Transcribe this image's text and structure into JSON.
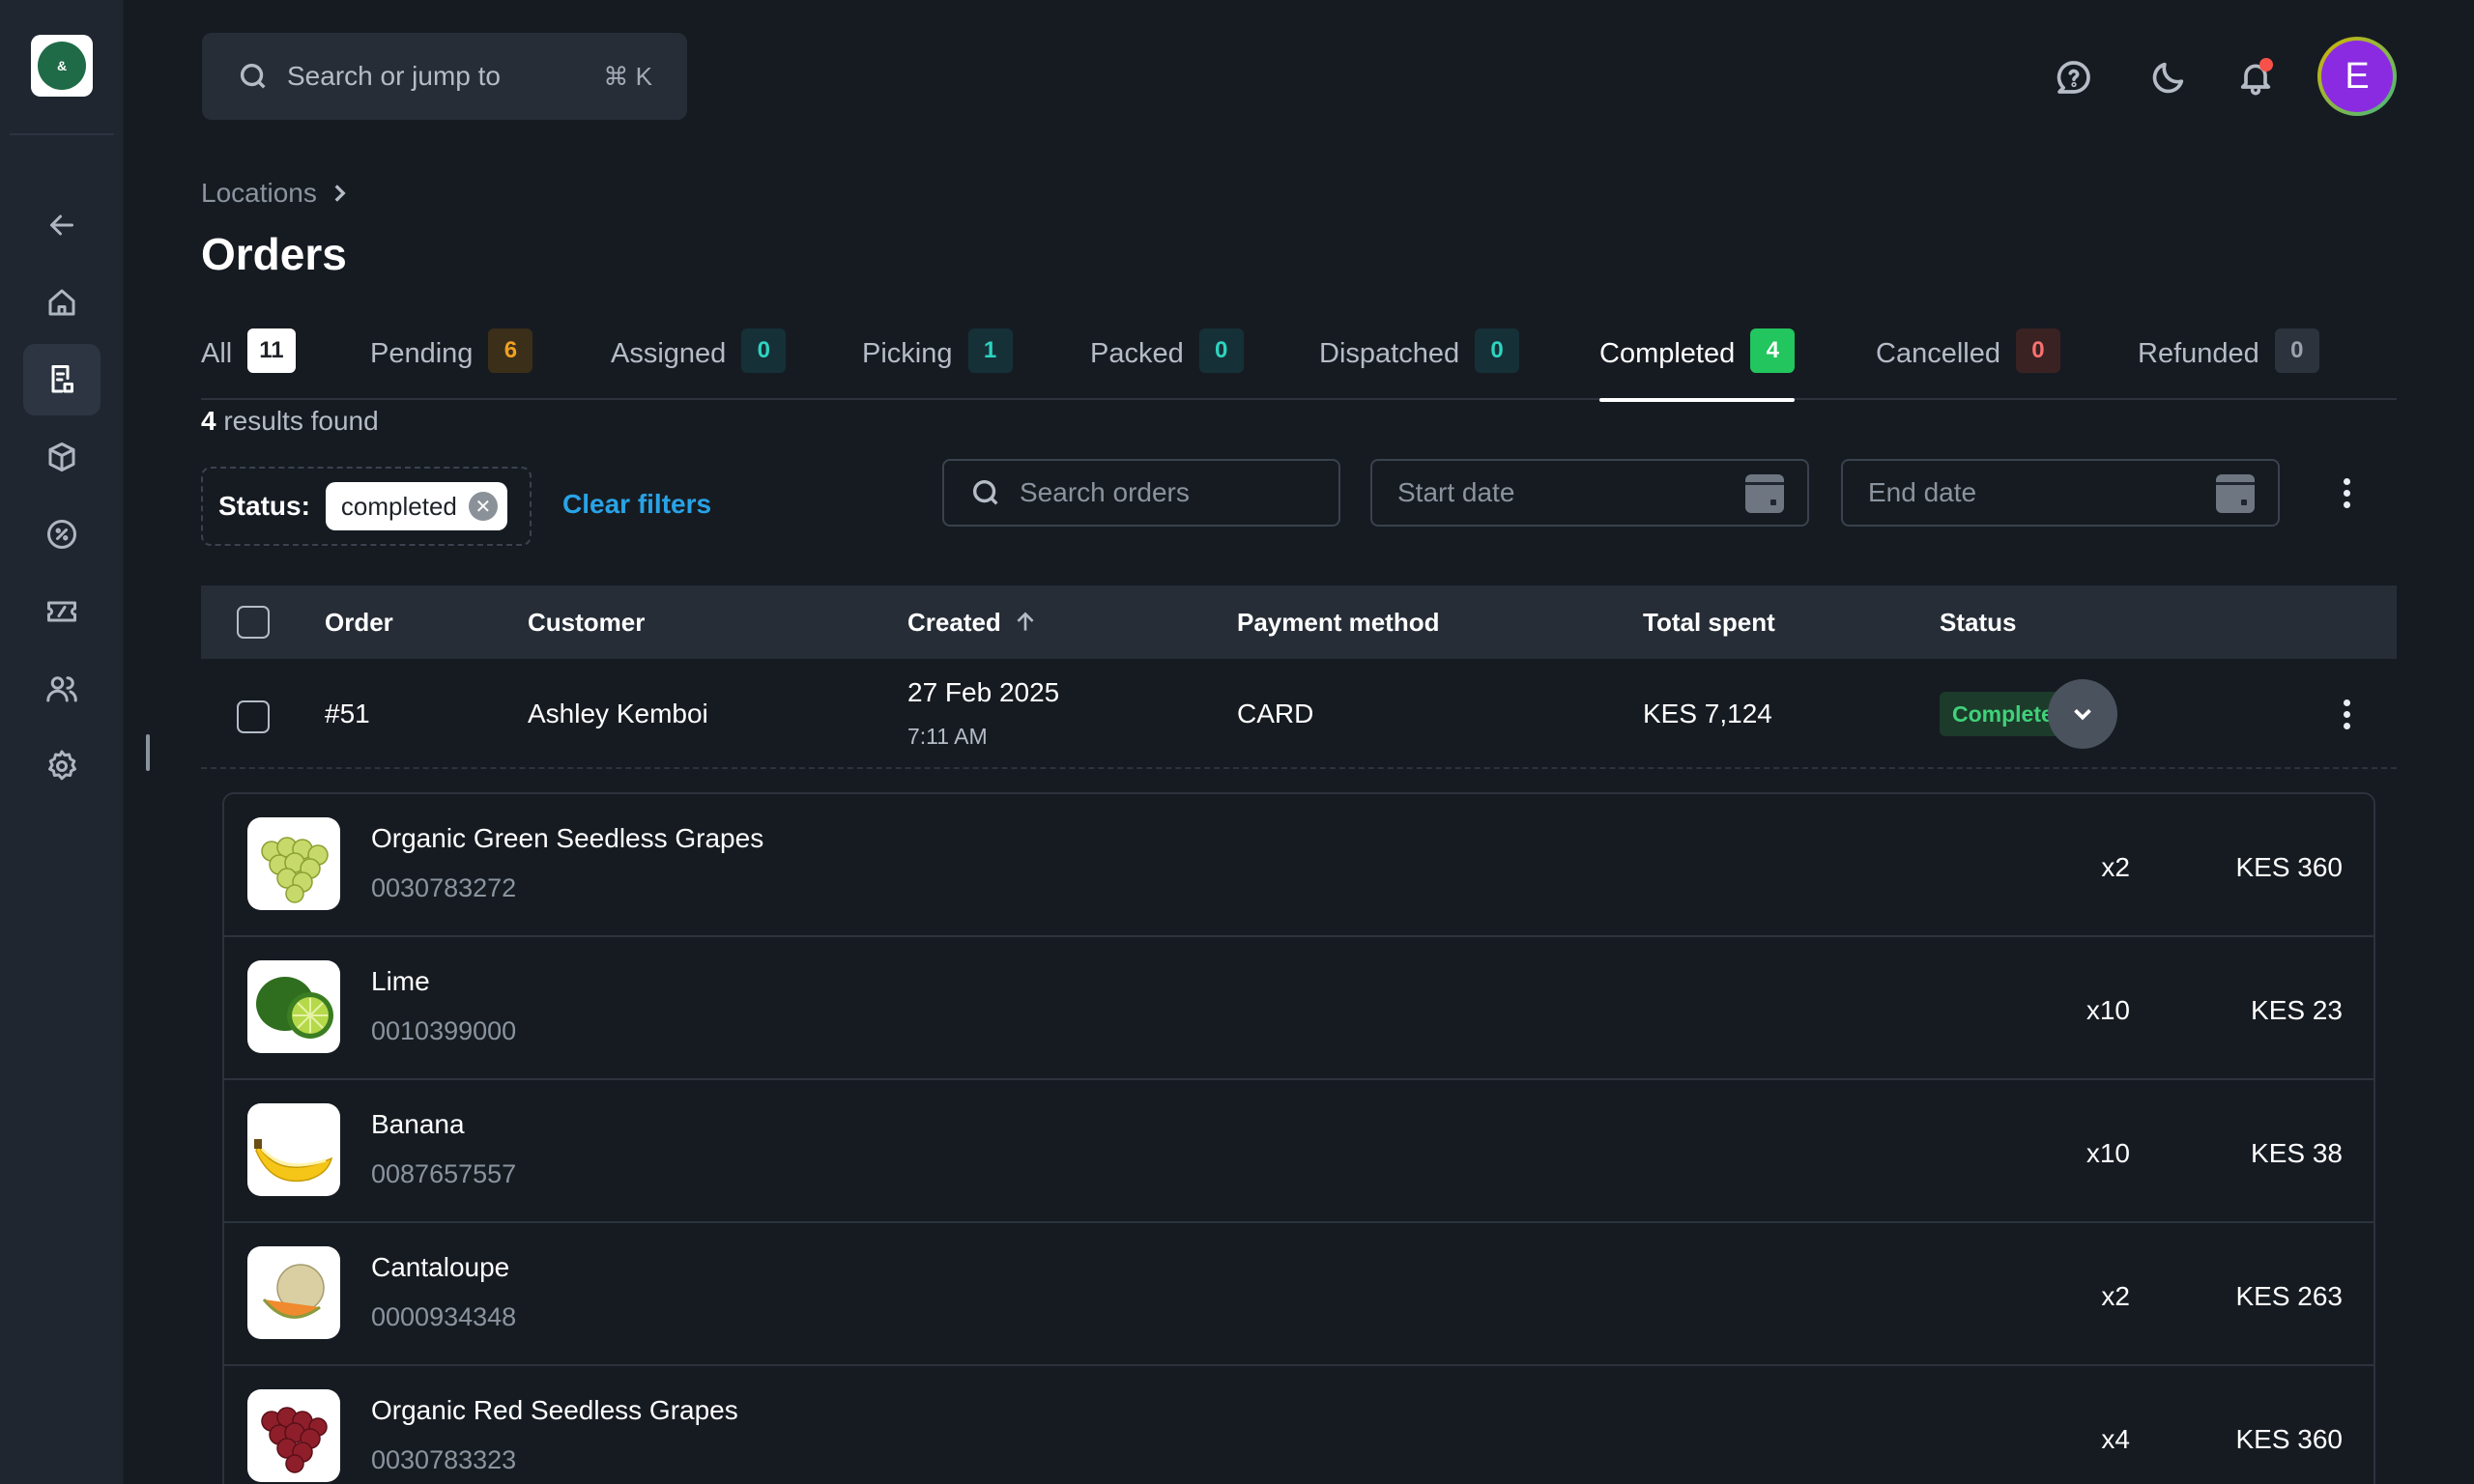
{
  "app": {
    "logo_text": "FRESH & EASY",
    "search_placeholder": "Search or jump to",
    "search_shortcut": "⌘ K",
    "avatar_initial": "E"
  },
  "breadcrumb": {
    "parent": "Locations"
  },
  "page": {
    "title": "Orders"
  },
  "tabs": [
    {
      "label": "All",
      "count": "11",
      "color": "#ffffff"
    },
    {
      "label": "Pending",
      "count": "6",
      "color": "#f0a020"
    },
    {
      "label": "Assigned",
      "count": "0",
      "color": "#2dd4bf"
    },
    {
      "label": "Picking",
      "count": "1",
      "color": "#2dd4bf"
    },
    {
      "label": "Packed",
      "count": "0",
      "color": "#2dd4bf"
    },
    {
      "label": "Dispatched",
      "count": "0",
      "color": "#2dd4bf"
    },
    {
      "label": "Completed",
      "count": "4",
      "color": "#22c55e"
    },
    {
      "label": "Cancelled",
      "count": "0",
      "color": "#f87171"
    },
    {
      "label": "Refunded",
      "count": "0",
      "color": "#9ca3af"
    }
  ],
  "results": {
    "count": "4",
    "label": "results found"
  },
  "filters": {
    "status_label": "Status:",
    "status_value": "completed",
    "clear_label": "Clear filters",
    "search_placeholder": "Search orders",
    "start_date_placeholder": "Start date",
    "end_date_placeholder": "End date"
  },
  "table": {
    "headers": {
      "order": "Order",
      "customer": "Customer",
      "created": "Created",
      "payment": "Payment method",
      "total": "Total spent",
      "status": "Status"
    },
    "rows": [
      {
        "order": "#51",
        "customer": "Ashley Kemboi",
        "created_date": "27 Feb 2025",
        "created_time": "7:11 AM",
        "payment": "CARD",
        "total": "KES 7,124",
        "status": "Completed"
      }
    ]
  },
  "order_items": [
    {
      "name": "Organic Green Seedless Grapes",
      "sku": "0030783272",
      "qty": "x2",
      "price": "KES 360",
      "thumb": "green-grapes"
    },
    {
      "name": "Lime",
      "sku": "0010399000",
      "qty": "x10",
      "price": "KES 23",
      "thumb": "lime"
    },
    {
      "name": "Banana",
      "sku": "0087657557",
      "qty": "x10",
      "price": "KES 38",
      "thumb": "banana"
    },
    {
      "name": "Cantaloupe",
      "sku": "0000934348",
      "qty": "x2",
      "price": "KES 263",
      "thumb": "cantaloupe"
    },
    {
      "name": "Organic Red Seedless Grapes",
      "sku": "0030783323",
      "qty": "x4",
      "price": "KES 360",
      "thumb": "red-grapes"
    }
  ]
}
